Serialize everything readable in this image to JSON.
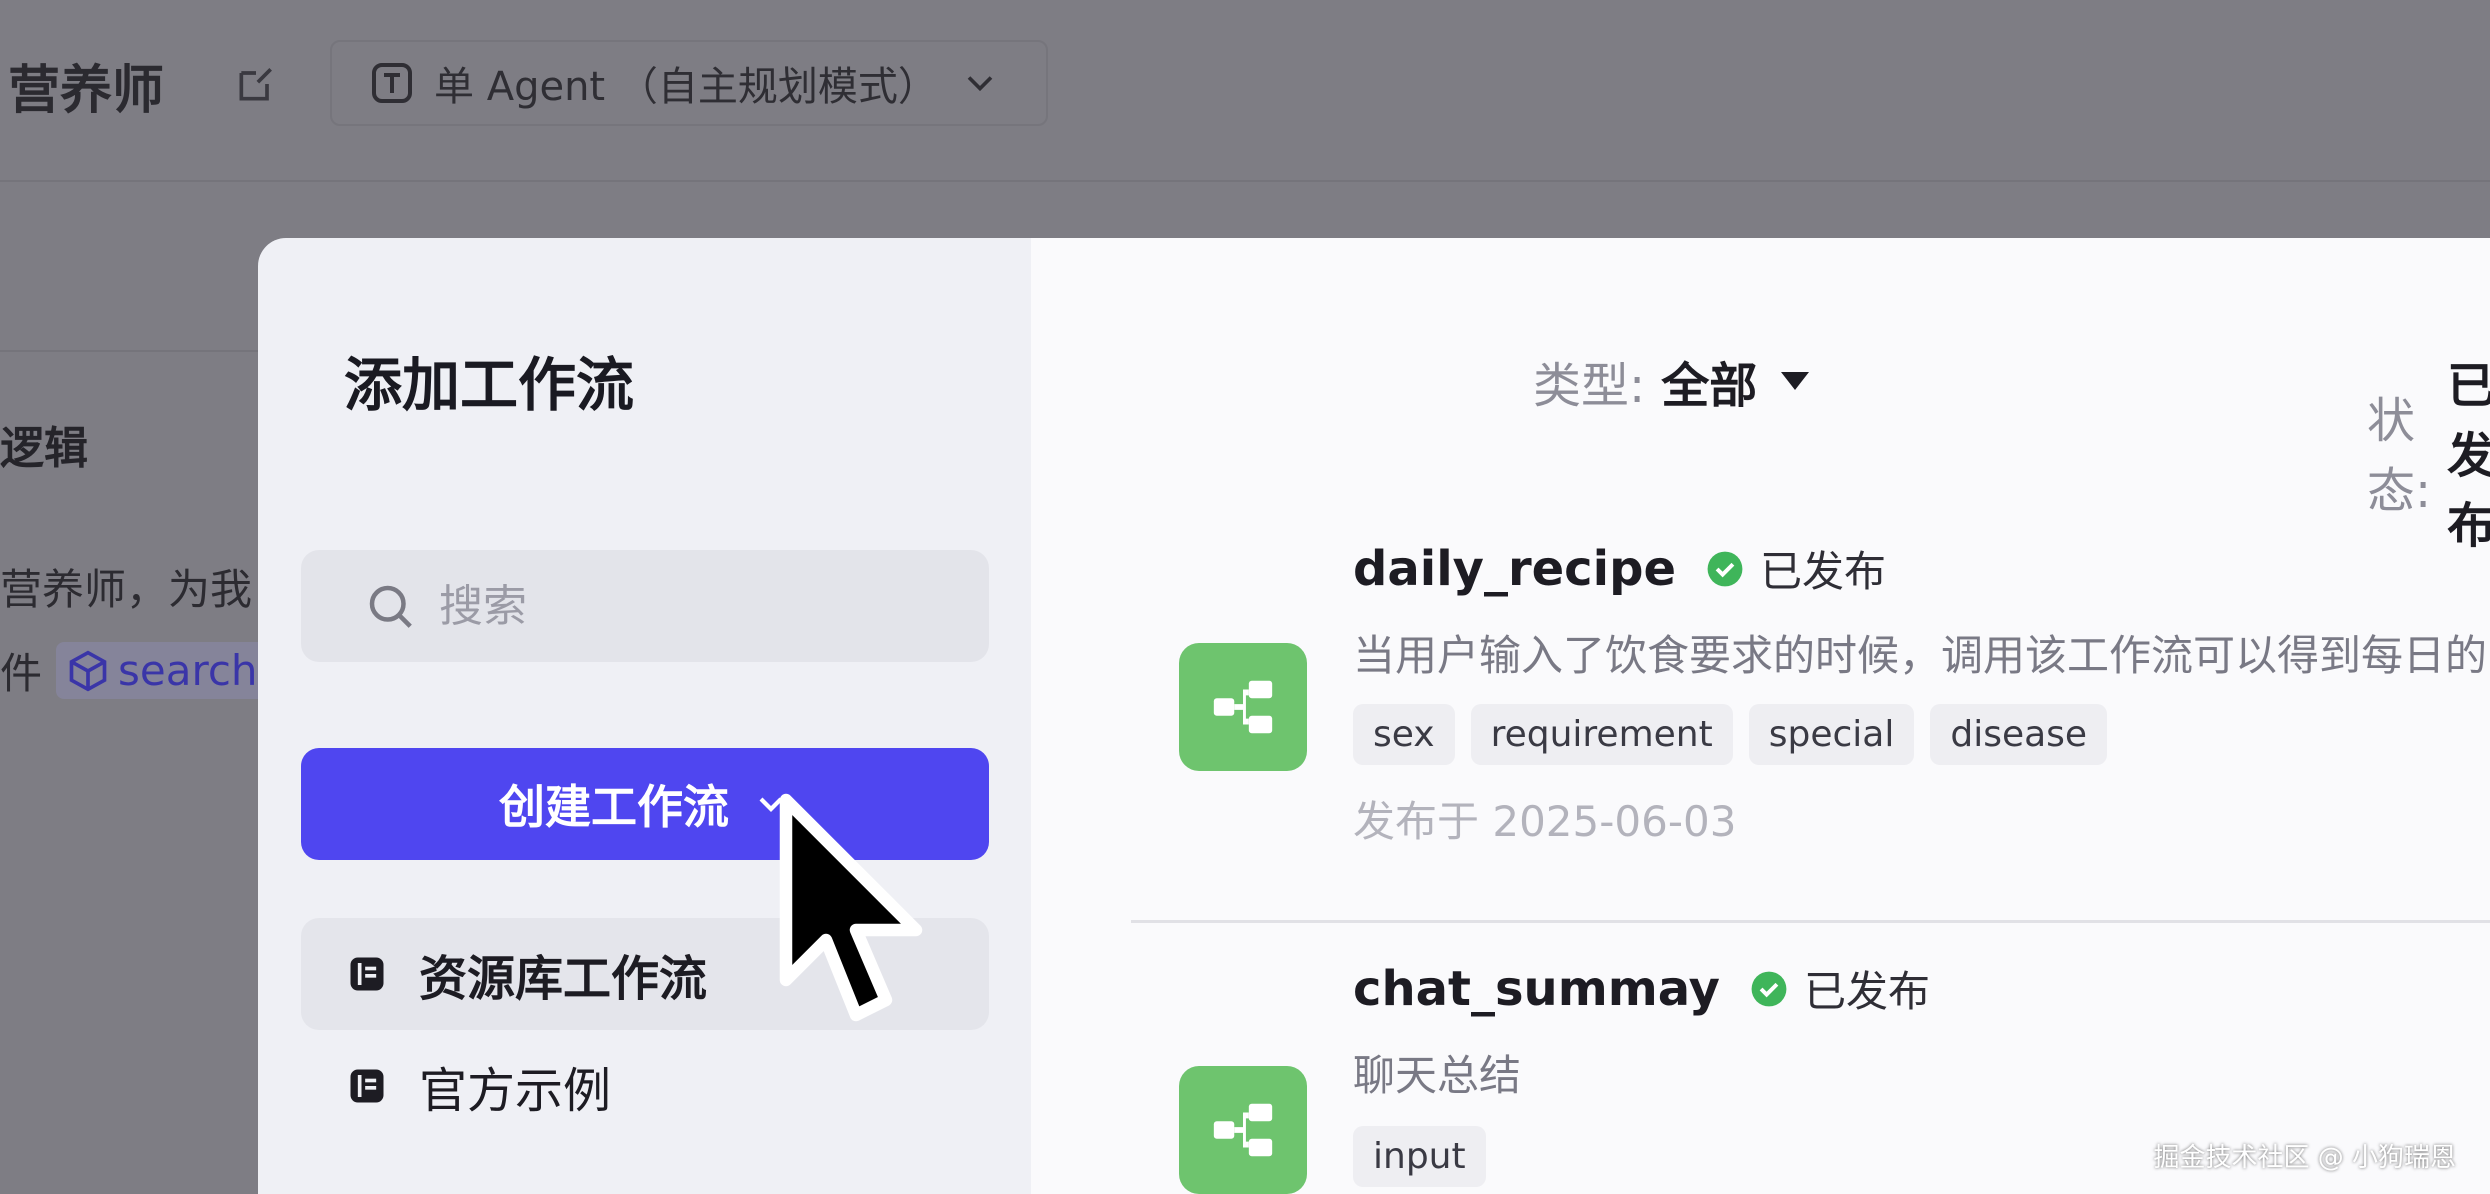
{
  "background": {
    "agent_name": "营养师",
    "mode_selector": "单 Agent （自主规划模式）",
    "section_title": "逻辑",
    "text_line1": "营养师，为我",
    "text_line2_prefix": "件",
    "plugin_chip": "search"
  },
  "modal": {
    "title": "添加工作流",
    "search_placeholder": "搜索",
    "create_button": "创建工作流",
    "nav": [
      {
        "label": "资源库工作流",
        "active": true
      },
      {
        "label": "官方示例",
        "active": false
      }
    ],
    "filters": {
      "type_label": "类型:",
      "type_value": "全部",
      "status_label": "状态:",
      "status_value": "已发布"
    },
    "workflows": [
      {
        "name": "daily_recipe",
        "status": "已发布",
        "description": "当用户输入了饮食要求的时候，调用该工作流可以得到每日的",
        "tags": [
          "sex",
          "requirement",
          "special",
          "disease"
        ],
        "published": "发布于 2025-06-03"
      },
      {
        "name": "chat_summay",
        "status": "已发布",
        "description": "聊天总结",
        "tags": [
          "input"
        ]
      }
    ]
  },
  "colors": {
    "accent": "#4f46f0",
    "workflow_icon": "#6ec46e",
    "status_ok": "#3fb55a",
    "overlay": "#7e7d84"
  },
  "watermark": "掘金技术社区 @ 小狗瑞恩"
}
